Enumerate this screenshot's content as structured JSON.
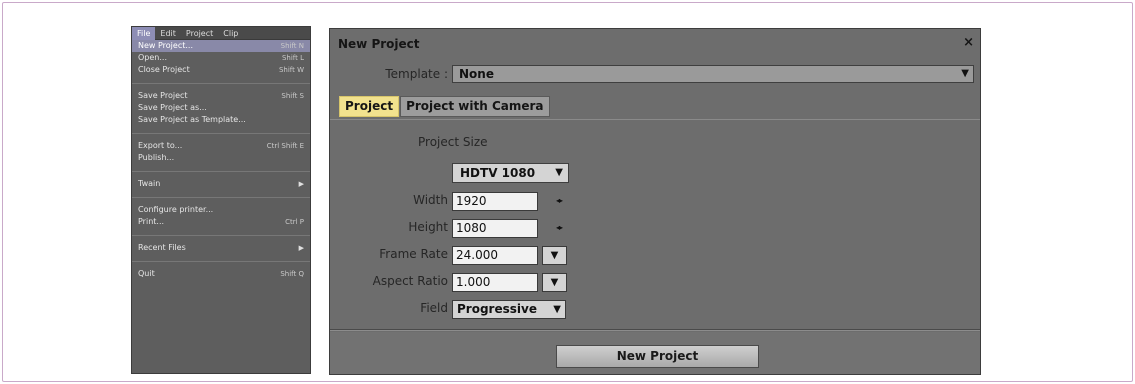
{
  "menubar": {
    "items": [
      "File",
      "Edit",
      "Project",
      "Clip"
    ]
  },
  "file_menu": {
    "new_project": {
      "label": "New Project...",
      "shortcut": "Shift N"
    },
    "open": {
      "label": "Open...",
      "shortcut": "Shift L"
    },
    "close_project": {
      "label": "Close Project",
      "shortcut": "Shift W"
    },
    "save_project": {
      "label": "Save Project",
      "shortcut": "Shift S"
    },
    "save_project_as": {
      "label": "Save Project as..."
    },
    "save_as_template": {
      "label": "Save Project as Template..."
    },
    "export_to": {
      "label": "Export to...",
      "shortcut": "Ctrl Shift E"
    },
    "publish": {
      "label": "Publish..."
    },
    "twain": {
      "label": "Twain"
    },
    "configure_printer": {
      "label": "Configure printer..."
    },
    "print": {
      "label": "Print...",
      "shortcut": "Ctrl P"
    },
    "recent_files": {
      "label": "Recent Files"
    },
    "quit": {
      "label": "Quit",
      "shortcut": "Shift Q"
    }
  },
  "dialog": {
    "title": "New Project",
    "close_glyph": "×",
    "template_label": "Template :",
    "template_value": "None",
    "tabs": [
      "Project",
      "Project with Camera"
    ],
    "project_size_label": "Project Size",
    "project_size_value": "HDTV 1080",
    "width_label": "Width",
    "width_value": "1920",
    "height_label": "Height",
    "height_value": "1080",
    "frame_rate_label": "Frame Rate",
    "frame_rate_value": "24.000",
    "aspect_ratio_label": "Aspect Ratio",
    "aspect_ratio_value": "1.000",
    "field_label": "Field",
    "field_value": "Progressive",
    "submit_label": "New Project"
  },
  "icons": {
    "dropdown": "▼",
    "submenu": "▶",
    "spin": "◂▸"
  }
}
